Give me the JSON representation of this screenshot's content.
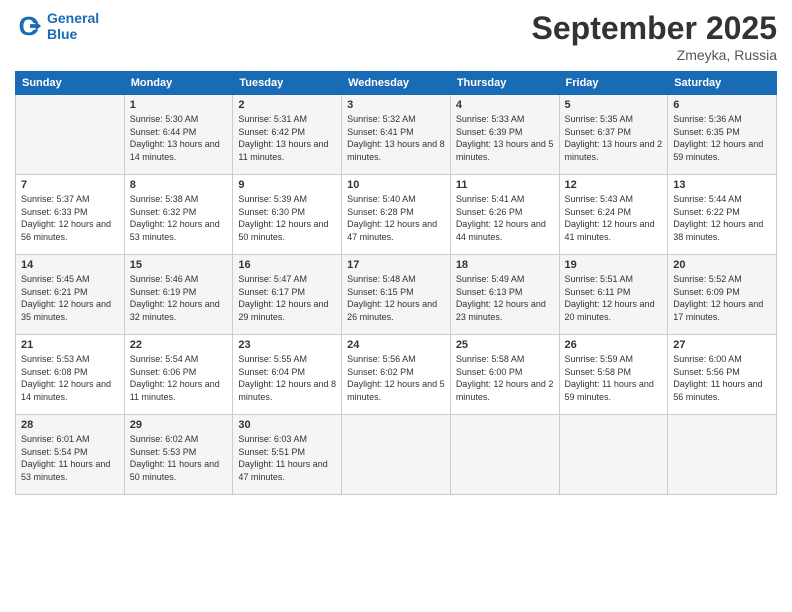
{
  "header": {
    "logo_line1": "General",
    "logo_line2": "Blue",
    "month": "September 2025",
    "location": "Zmeyka, Russia"
  },
  "weekdays": [
    "Sunday",
    "Monday",
    "Tuesday",
    "Wednesday",
    "Thursday",
    "Friday",
    "Saturday"
  ],
  "weeks": [
    [
      {
        "day": "",
        "sunrise": "",
        "sunset": "",
        "daylight": ""
      },
      {
        "day": "1",
        "sunrise": "Sunrise: 5:30 AM",
        "sunset": "Sunset: 6:44 PM",
        "daylight": "Daylight: 13 hours and 14 minutes."
      },
      {
        "day": "2",
        "sunrise": "Sunrise: 5:31 AM",
        "sunset": "Sunset: 6:42 PM",
        "daylight": "Daylight: 13 hours and 11 minutes."
      },
      {
        "day": "3",
        "sunrise": "Sunrise: 5:32 AM",
        "sunset": "Sunset: 6:41 PM",
        "daylight": "Daylight: 13 hours and 8 minutes."
      },
      {
        "day": "4",
        "sunrise": "Sunrise: 5:33 AM",
        "sunset": "Sunset: 6:39 PM",
        "daylight": "Daylight: 13 hours and 5 minutes."
      },
      {
        "day": "5",
        "sunrise": "Sunrise: 5:35 AM",
        "sunset": "Sunset: 6:37 PM",
        "daylight": "Daylight: 13 hours and 2 minutes."
      },
      {
        "day": "6",
        "sunrise": "Sunrise: 5:36 AM",
        "sunset": "Sunset: 6:35 PM",
        "daylight": "Daylight: 12 hours and 59 minutes."
      }
    ],
    [
      {
        "day": "7",
        "sunrise": "Sunrise: 5:37 AM",
        "sunset": "Sunset: 6:33 PM",
        "daylight": "Daylight: 12 hours and 56 minutes."
      },
      {
        "day": "8",
        "sunrise": "Sunrise: 5:38 AM",
        "sunset": "Sunset: 6:32 PM",
        "daylight": "Daylight: 12 hours and 53 minutes."
      },
      {
        "day": "9",
        "sunrise": "Sunrise: 5:39 AM",
        "sunset": "Sunset: 6:30 PM",
        "daylight": "Daylight: 12 hours and 50 minutes."
      },
      {
        "day": "10",
        "sunrise": "Sunrise: 5:40 AM",
        "sunset": "Sunset: 6:28 PM",
        "daylight": "Daylight: 12 hours and 47 minutes."
      },
      {
        "day": "11",
        "sunrise": "Sunrise: 5:41 AM",
        "sunset": "Sunset: 6:26 PM",
        "daylight": "Daylight: 12 hours and 44 minutes."
      },
      {
        "day": "12",
        "sunrise": "Sunrise: 5:43 AM",
        "sunset": "Sunset: 6:24 PM",
        "daylight": "Daylight: 12 hours and 41 minutes."
      },
      {
        "day": "13",
        "sunrise": "Sunrise: 5:44 AM",
        "sunset": "Sunset: 6:22 PM",
        "daylight": "Daylight: 12 hours and 38 minutes."
      }
    ],
    [
      {
        "day": "14",
        "sunrise": "Sunrise: 5:45 AM",
        "sunset": "Sunset: 6:21 PM",
        "daylight": "Daylight: 12 hours and 35 minutes."
      },
      {
        "day": "15",
        "sunrise": "Sunrise: 5:46 AM",
        "sunset": "Sunset: 6:19 PM",
        "daylight": "Daylight: 12 hours and 32 minutes."
      },
      {
        "day": "16",
        "sunrise": "Sunrise: 5:47 AM",
        "sunset": "Sunset: 6:17 PM",
        "daylight": "Daylight: 12 hours and 29 minutes."
      },
      {
        "day": "17",
        "sunrise": "Sunrise: 5:48 AM",
        "sunset": "Sunset: 6:15 PM",
        "daylight": "Daylight: 12 hours and 26 minutes."
      },
      {
        "day": "18",
        "sunrise": "Sunrise: 5:49 AM",
        "sunset": "Sunset: 6:13 PM",
        "daylight": "Daylight: 12 hours and 23 minutes."
      },
      {
        "day": "19",
        "sunrise": "Sunrise: 5:51 AM",
        "sunset": "Sunset: 6:11 PM",
        "daylight": "Daylight: 12 hours and 20 minutes."
      },
      {
        "day": "20",
        "sunrise": "Sunrise: 5:52 AM",
        "sunset": "Sunset: 6:09 PM",
        "daylight": "Daylight: 12 hours and 17 minutes."
      }
    ],
    [
      {
        "day": "21",
        "sunrise": "Sunrise: 5:53 AM",
        "sunset": "Sunset: 6:08 PM",
        "daylight": "Daylight: 12 hours and 14 minutes."
      },
      {
        "day": "22",
        "sunrise": "Sunrise: 5:54 AM",
        "sunset": "Sunset: 6:06 PM",
        "daylight": "Daylight: 12 hours and 11 minutes."
      },
      {
        "day": "23",
        "sunrise": "Sunrise: 5:55 AM",
        "sunset": "Sunset: 6:04 PM",
        "daylight": "Daylight: 12 hours and 8 minutes."
      },
      {
        "day": "24",
        "sunrise": "Sunrise: 5:56 AM",
        "sunset": "Sunset: 6:02 PM",
        "daylight": "Daylight: 12 hours and 5 minutes."
      },
      {
        "day": "25",
        "sunrise": "Sunrise: 5:58 AM",
        "sunset": "Sunset: 6:00 PM",
        "daylight": "Daylight: 12 hours and 2 minutes."
      },
      {
        "day": "26",
        "sunrise": "Sunrise: 5:59 AM",
        "sunset": "Sunset: 5:58 PM",
        "daylight": "Daylight: 11 hours and 59 minutes."
      },
      {
        "day": "27",
        "sunrise": "Sunrise: 6:00 AM",
        "sunset": "Sunset: 5:56 PM",
        "daylight": "Daylight: 11 hours and 56 minutes."
      }
    ],
    [
      {
        "day": "28",
        "sunrise": "Sunrise: 6:01 AM",
        "sunset": "Sunset: 5:54 PM",
        "daylight": "Daylight: 11 hours and 53 minutes."
      },
      {
        "day": "29",
        "sunrise": "Sunrise: 6:02 AM",
        "sunset": "Sunset: 5:53 PM",
        "daylight": "Daylight: 11 hours and 50 minutes."
      },
      {
        "day": "30",
        "sunrise": "Sunrise: 6:03 AM",
        "sunset": "Sunset: 5:51 PM",
        "daylight": "Daylight: 11 hours and 47 minutes."
      },
      {
        "day": "",
        "sunrise": "",
        "sunset": "",
        "daylight": ""
      },
      {
        "day": "",
        "sunrise": "",
        "sunset": "",
        "daylight": ""
      },
      {
        "day": "",
        "sunrise": "",
        "sunset": "",
        "daylight": ""
      },
      {
        "day": "",
        "sunrise": "",
        "sunset": "",
        "daylight": ""
      }
    ]
  ]
}
